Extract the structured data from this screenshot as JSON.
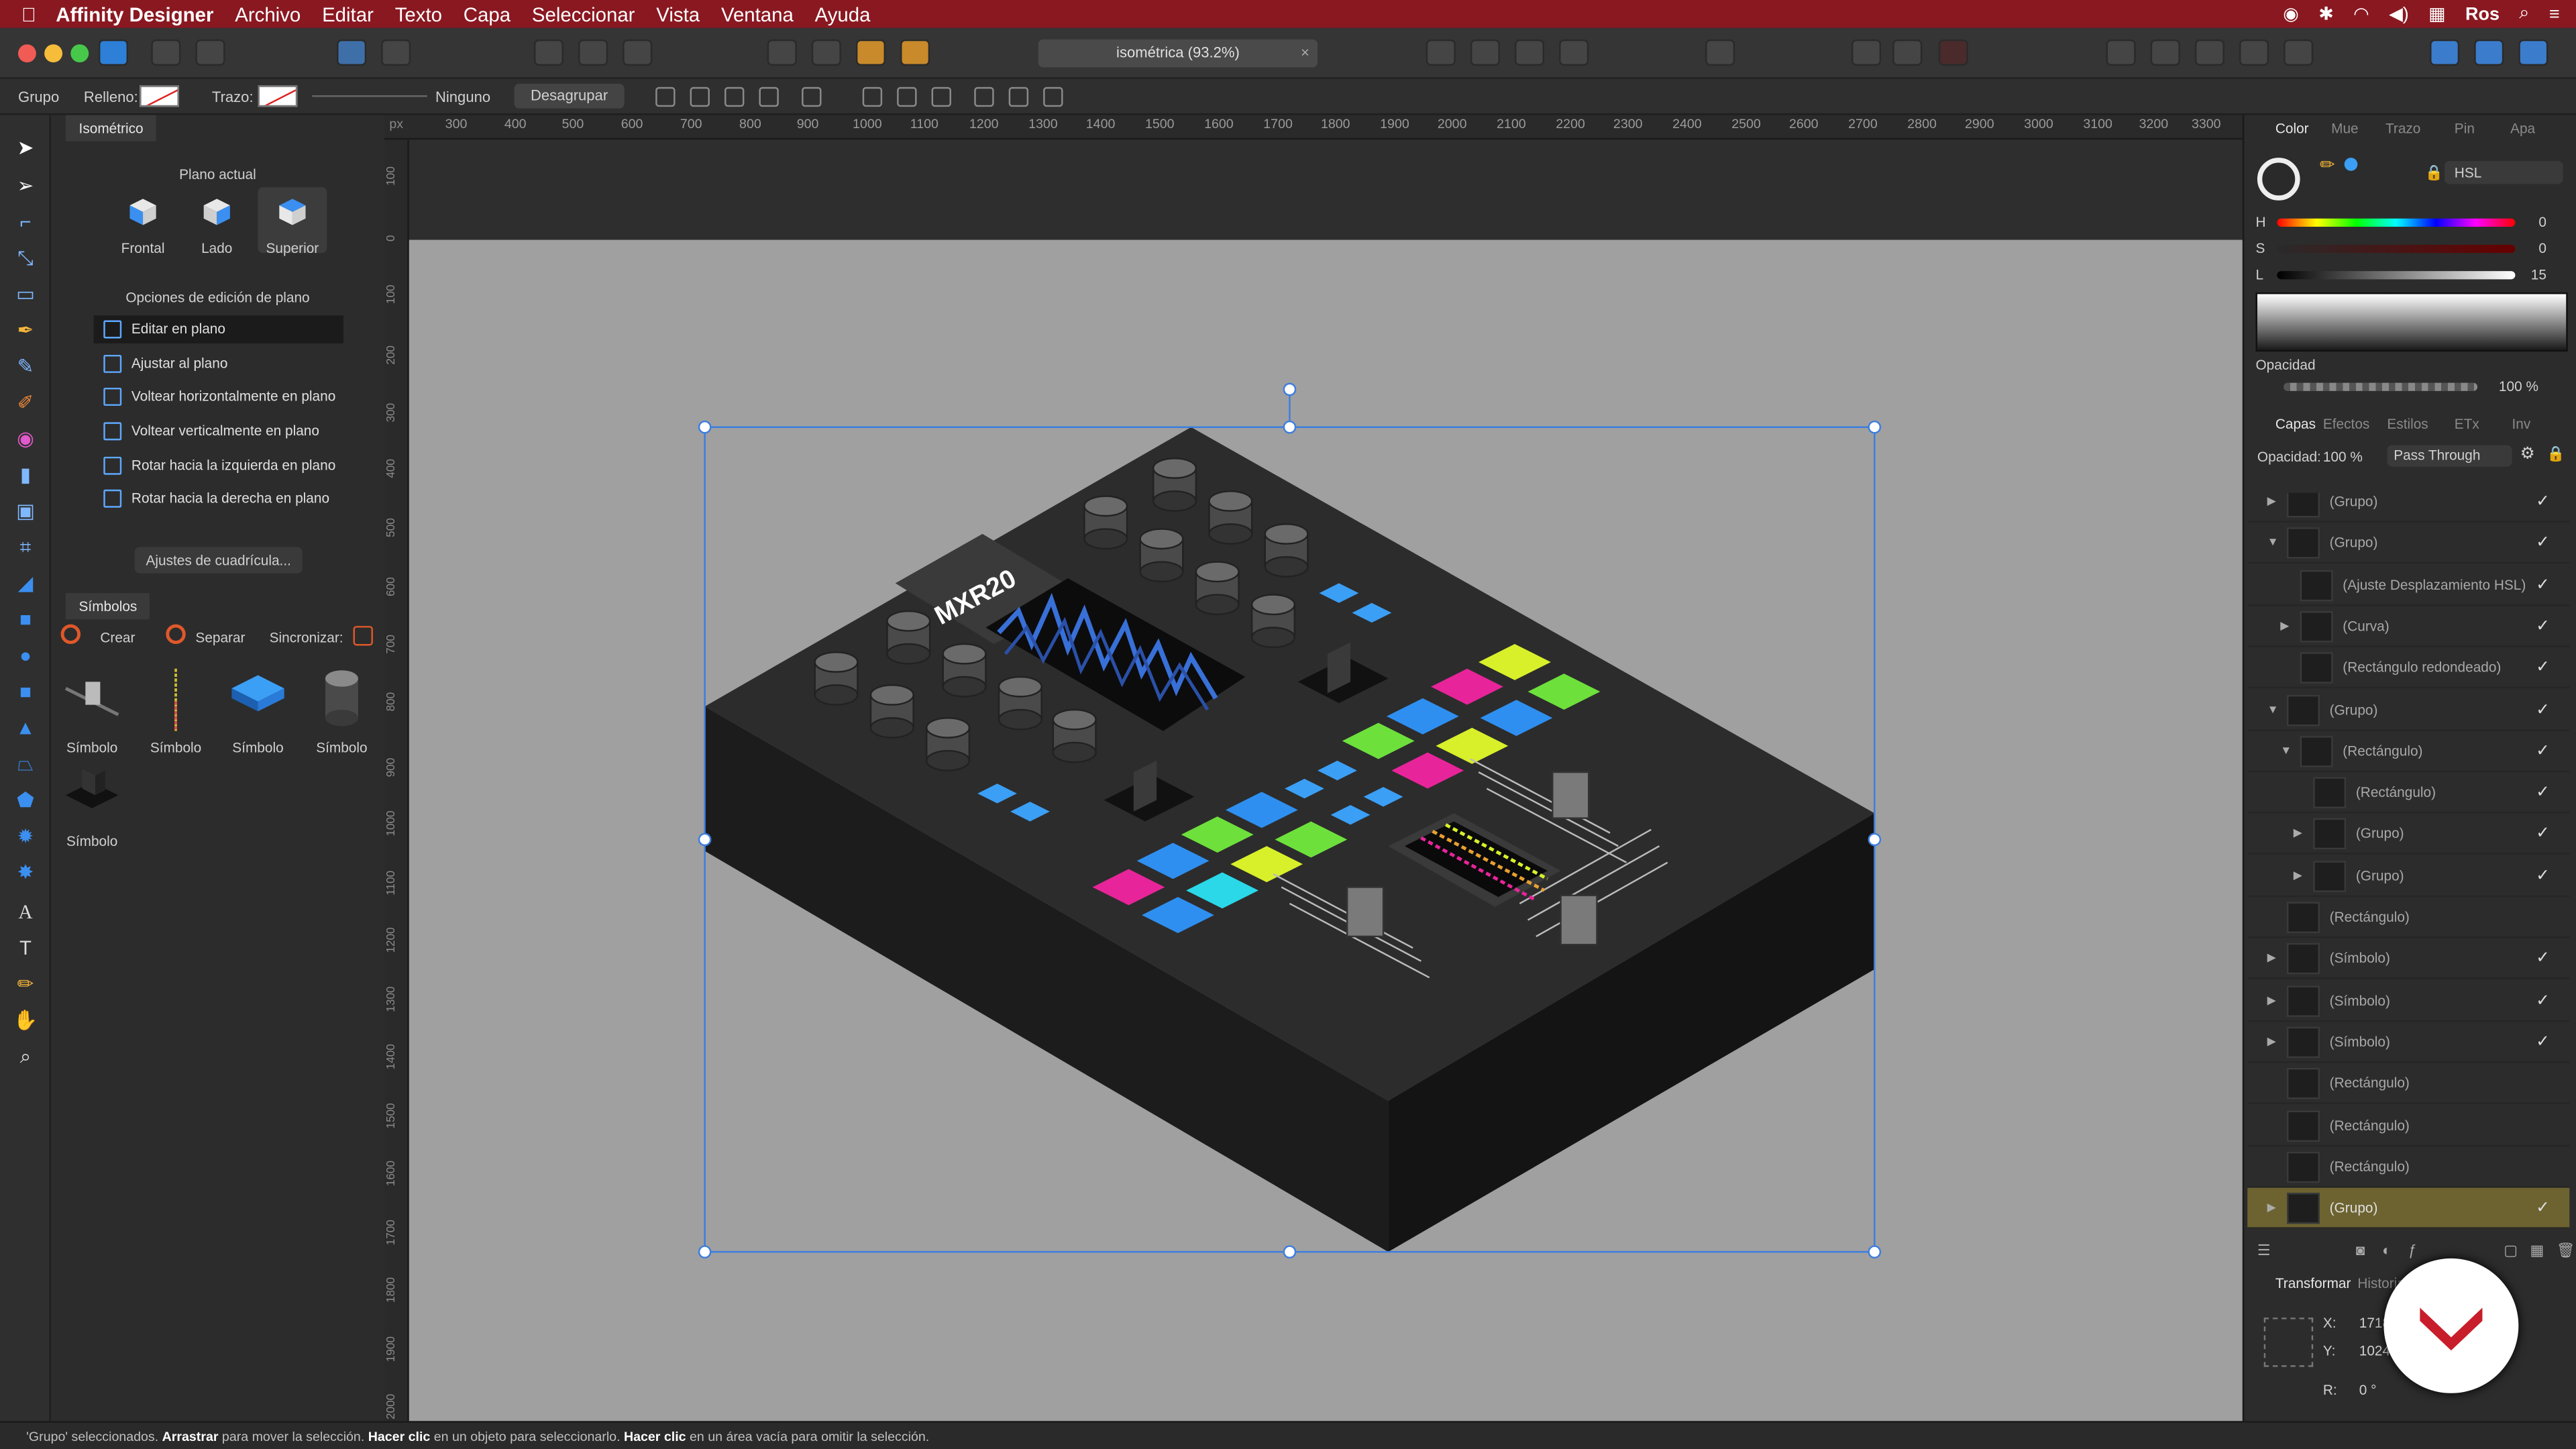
{
  "menubar": {
    "app_name": "Affinity Designer",
    "items": [
      "Archivo",
      "Editar",
      "Texto",
      "Capa",
      "Seleccionar",
      "Vista",
      "Ventana",
      "Ayuda"
    ],
    "user": "Ros"
  },
  "toolbar": {
    "document_tab": "isométrica (93.2%)",
    "close_glyph": "×"
  },
  "context_bar": {
    "selection_type": "Grupo",
    "fill_label": "Relleno:",
    "stroke_label": "Trazo:",
    "stroke_value": "Ninguno",
    "ungroup_label": "Desagrupar"
  },
  "iso_panel": {
    "tab": "Isométrico",
    "current_plane_title": "Plano actual",
    "planes": [
      "Frontal",
      "Lado",
      "Superior"
    ],
    "selected_plane": "Superior",
    "edit_options_title": "Opciones de edición de plano",
    "options": [
      "Editar en plano",
      "Ajustar al plano",
      "Voltear horizontalmente en plano",
      "Voltear verticalmente en plano",
      "Rotar hacia la izquierda en plano",
      "Rotar hacia la derecha en plano"
    ],
    "selected_option": "Editar en plano",
    "grid_button": "Ajustes de cuadrícula..."
  },
  "symbols_panel": {
    "tab": "Símbolos",
    "create": "Crear",
    "detach": "Separar",
    "sync": "Sincronizar:",
    "items": [
      "Símbolo",
      "Símbolo",
      "Símbolo",
      "Símbolo",
      "Símbolo"
    ]
  },
  "ruler": {
    "top": [
      "300",
      "400",
      "500",
      "600",
      "700",
      "800",
      "900",
      "1000",
      "1100",
      "1200",
      "1300",
      "1400",
      "1500",
      "1600",
      "1700",
      "1800",
      "1900",
      "2000",
      "2100",
      "2200",
      "2300",
      "2400",
      "2500",
      "2600",
      "2700",
      "2800",
      "2900",
      "3000",
      "3100",
      "3200",
      "3300"
    ],
    "left": [
      "100",
      "0",
      "100",
      "200",
      "300",
      "400",
      "500",
      "600",
      "700",
      "800",
      "900",
      "1000",
      "1100",
      "1200",
      "1300",
      "1400",
      "1500",
      "1600",
      "1700",
      "1800",
      "1900",
      "2000"
    ],
    "unit": "px"
  },
  "canvas": {
    "brand_text": "MXR20",
    "colors": {
      "pink": "#e8249a",
      "green": "#6ee03c",
      "yellow": "#d8f02a",
      "cyan": "#2ad8e8",
      "blue": "#2f8ff0",
      "body": "#2a2a2a",
      "artboard": "#a0a0a0",
      "selection": "#3c7de0"
    }
  },
  "color_panel": {
    "tabs": [
      "Color",
      "Mue",
      "Trazo",
      "Pin",
      "Apa"
    ],
    "mode": "HSL",
    "h_label": "H",
    "h_value": "0",
    "s_label": "S",
    "s_value": "0",
    "l_label": "L",
    "l_value": "15",
    "opacity_label": "Opacidad",
    "opacity_value": "100 %"
  },
  "layers_panel": {
    "tabs": [
      "Capas",
      "Efectos",
      "Estilos",
      "ETx",
      "Inv"
    ],
    "opacity_label": "Opacidad:",
    "opacity_value": "100 %",
    "blend_mode": "Pass Through",
    "layers": [
      {
        "name": "(Grupo)",
        "indent": 0,
        "tri": "▶",
        "visible": true
      },
      {
        "name": "(Grupo)",
        "indent": 0,
        "tri": "▼",
        "visible": true
      },
      {
        "name": "(Ajuste Desplazamiento HSL)",
        "indent": 1,
        "tri": "",
        "visible": true
      },
      {
        "name": "(Curva)",
        "indent": 1,
        "tri": "▶",
        "visible": true
      },
      {
        "name": "(Rectángulo redondeado)",
        "indent": 1,
        "tri": "",
        "visible": true
      },
      {
        "name": "(Grupo)",
        "indent": 0,
        "tri": "▼",
        "visible": true
      },
      {
        "name": "(Rectángulo)",
        "indent": 1,
        "tri": "▼",
        "visible": true
      },
      {
        "name": "(Rectángulo)",
        "indent": 2,
        "tri": "",
        "visible": true
      },
      {
        "name": "(Grupo)",
        "indent": 2,
        "tri": "▶",
        "visible": true
      },
      {
        "name": "(Grupo)",
        "indent": 2,
        "tri": "▶",
        "visible": true
      },
      {
        "name": "(Rectángulo)",
        "indent": 0,
        "tri": "",
        "visible": false
      },
      {
        "name": "(Símbolo)",
        "indent": 0,
        "tri": "▶",
        "visible": true
      },
      {
        "name": "(Símbolo)",
        "indent": 0,
        "tri": "▶",
        "visible": true
      },
      {
        "name": "(Símbolo)",
        "indent": 0,
        "tri": "▶",
        "visible": true
      },
      {
        "name": "(Rectángulo)",
        "indent": 0,
        "tri": "",
        "visible": false
      },
      {
        "name": "(Rectángulo)",
        "indent": 0,
        "tri": "",
        "visible": false
      },
      {
        "name": "(Rectángulo)",
        "indent": 0,
        "tri": "",
        "visible": false
      },
      {
        "name": "(Grupo)",
        "indent": 0,
        "tri": "▶",
        "visible": true,
        "selected": true
      }
    ]
  },
  "transform_panel": {
    "tabs": [
      "Transformar",
      "Historial"
    ],
    "x_label": "X:",
    "x_value": "1718",
    "y_label": "Y:",
    "y_value": "1024",
    "r_label": "R:",
    "r_value": "0 °"
  },
  "status": {
    "prefix": "'Grupo' seleccionados. ",
    "b1": "Arrastrar",
    "t1": " para mover la selección. ",
    "b2": "Hacer clic",
    "t2": " en un objeto para seleccionarlo. ",
    "b3": "Hacer clic",
    "t3": " en un área vacía para omitir la selección."
  }
}
